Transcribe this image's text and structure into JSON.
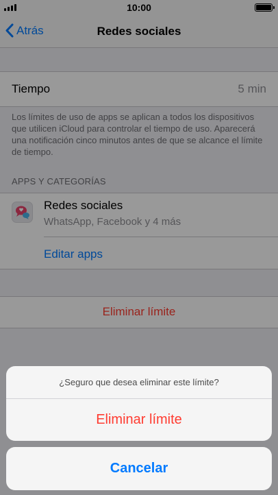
{
  "status_bar": {
    "time": "10:00",
    "signal_icon": "cellular-signal-icon",
    "battery_icon": "battery-icon"
  },
  "nav": {
    "back_label": "Atrás",
    "back_icon": "chevron-left-icon",
    "title": "Redes sociales"
  },
  "time_row": {
    "label": "Tiempo",
    "value": "5 min"
  },
  "footnote": "Los límites de uso de apps se aplican a todos los dispositivos que utilicen iCloud para controlar el tiempo de uso. Aparecerá una notificación cinco minutos antes de que se alcance el límite de tiempo.",
  "apps_section": {
    "header": "APPS Y CATEGORÍAS",
    "category": {
      "name": "Redes sociales",
      "subtitle": "WhatsApp, Facebook y 4 más",
      "icon": "social-chat-bubbles-icon"
    },
    "edit_label": "Editar apps"
  },
  "remove_row": {
    "label": "Eliminar límite"
  },
  "action_sheet": {
    "message": "¿Seguro que desea eliminar este límite?",
    "destructive_label": "Eliminar límite",
    "cancel_label": "Cancelar"
  },
  "colors": {
    "tint": "#007aff",
    "destructive": "#ff3b30",
    "background": "#efeff4"
  }
}
